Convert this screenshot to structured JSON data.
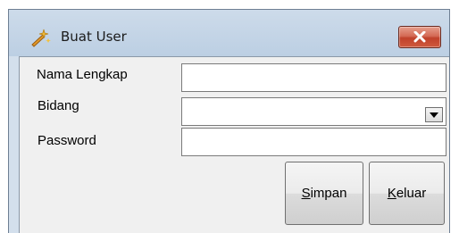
{
  "window": {
    "title": "Buat User",
    "icon": "wand-icon"
  },
  "form": {
    "nama_lengkap": {
      "label": "Nama Lengkap",
      "value": ""
    },
    "bidang": {
      "label": "Bidang",
      "value": ""
    },
    "password": {
      "label": "Password",
      "value": ""
    }
  },
  "buttons": {
    "simpan": {
      "mnemonic": "S",
      "rest": "impan"
    },
    "keluar": {
      "mnemonic": "K",
      "rest": "eluar"
    }
  },
  "colors": {
    "close_button": "#c0412a",
    "title_bar": "#cddbea"
  }
}
